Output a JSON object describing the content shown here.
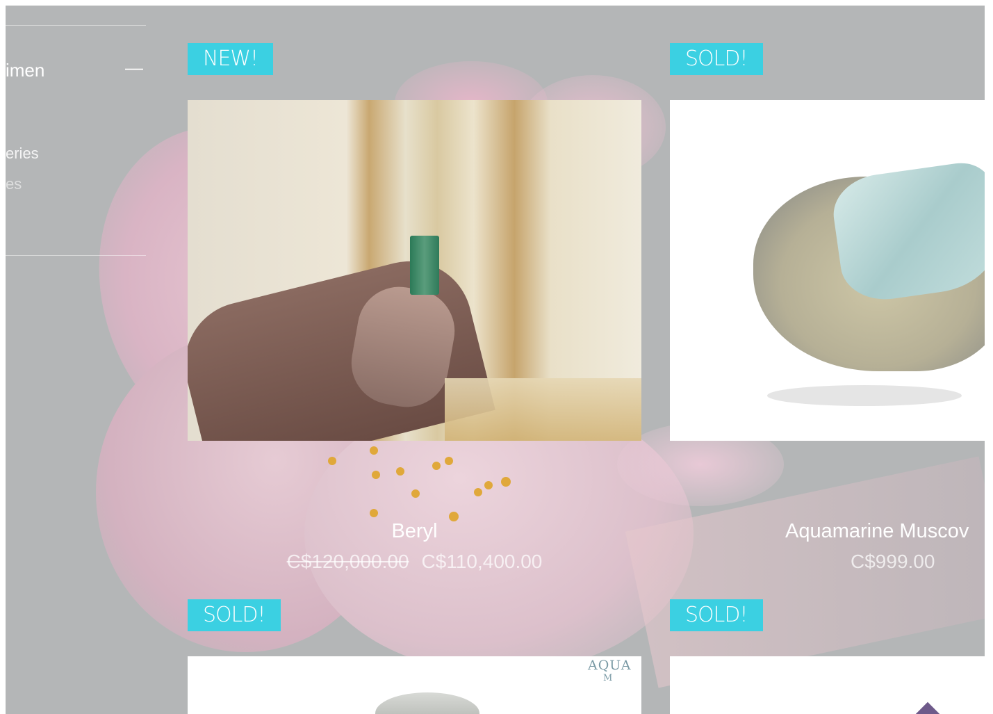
{
  "sidebar": {
    "filter_title_fragment": "imen",
    "collapse_symbol": "—",
    "item1_fragment": "eries",
    "item2_fragment": "es"
  },
  "products": [
    {
      "badge": "NEW!",
      "name": "Beryl",
      "original_price": "C$120,000.00",
      "price": "C$110,400.00",
      "image": "hand holding green emerald crystal"
    },
    {
      "badge": "SOLD!",
      "name": "Aquamarine Muscov",
      "price": "C$999.00",
      "image": "aquamarine on muscovite specimen"
    },
    {
      "badge": "SOLD!",
      "watermark": "AQUA",
      "watermark2": "M",
      "image": "crystal specimen on white"
    },
    {
      "badge": "SOLD!",
      "image": "amethyst specimen on white"
    }
  ],
  "colors": {
    "badge": "#3bd0e2",
    "overlay": "#b4b6b7"
  }
}
